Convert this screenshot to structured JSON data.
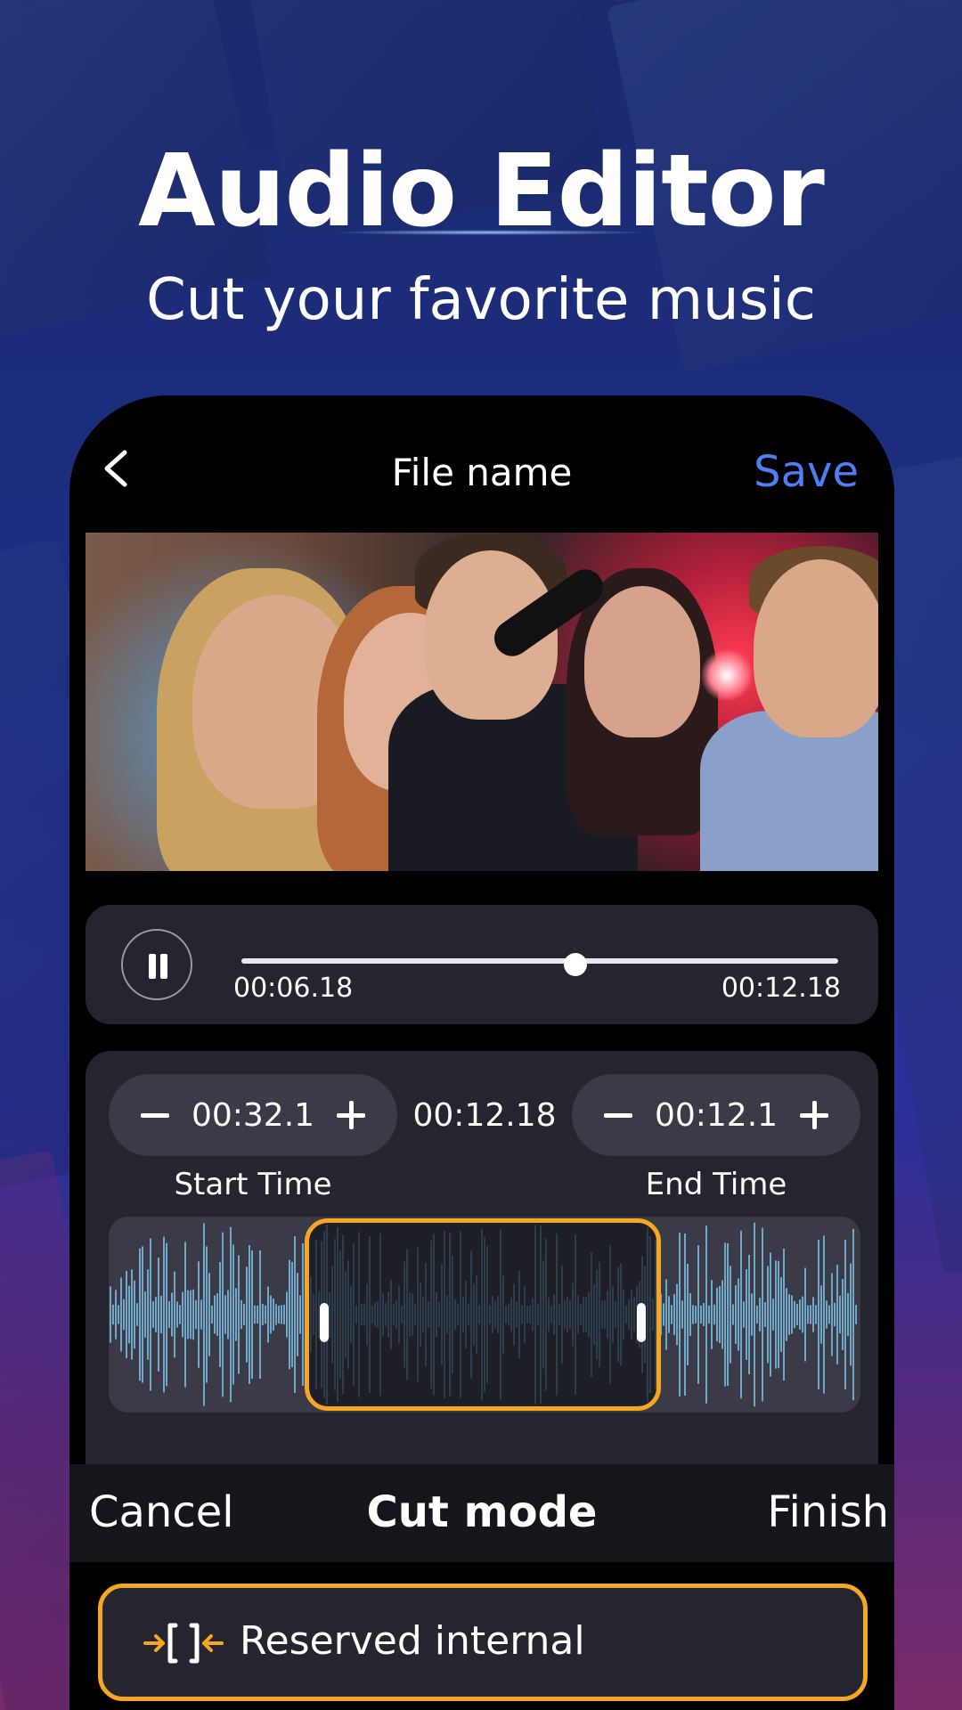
{
  "hero": {
    "title": "Audio Editor",
    "subtitle": "Cut your favorite music"
  },
  "topbar": {
    "back_icon": "chevron-left-icon",
    "file_name": "File name",
    "save_label": "Save",
    "accent_color": "#4f7df5"
  },
  "player": {
    "pause_icon": "pause-icon",
    "current_time": "00:06.18",
    "total_time": "00:12.18",
    "progress": 0.56
  },
  "cut": {
    "start": {
      "value": "00:32.1",
      "label": "Start Time"
    },
    "duration": "00:12.18",
    "end": {
      "value": "00:12.1",
      "label": "End Time"
    },
    "selection_color": "#f5a623",
    "waveform_color": "#7fc4ec"
  },
  "actions": {
    "cancel_label": "Cancel",
    "mode_title": "Cut mode",
    "finish_label": "Finish"
  },
  "option": {
    "icon": "reserve-interval-icon",
    "label": "Reserved internal",
    "highlight_color": "#f5a623"
  }
}
